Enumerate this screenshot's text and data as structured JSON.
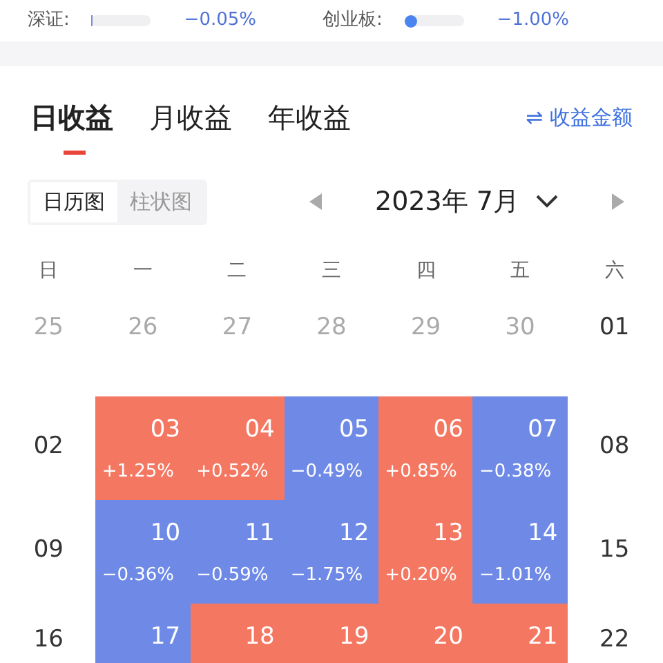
{
  "indices": [
    {
      "label": "深证:",
      "kind": "tick",
      "level": 0.0,
      "reading": "−0.05%"
    },
    {
      "label": "创业板:",
      "kind": "dot",
      "level": 0.0,
      "reading": "−1.00%"
    }
  ],
  "tabs": [
    {
      "label": "日收益",
      "selected": true
    },
    {
      "label": "月收益",
      "selected": false
    },
    {
      "label": "年收益",
      "selected": false
    }
  ],
  "toggle_link": {
    "icon": "⇌",
    "label": "收益金额"
  },
  "views": [
    {
      "label": "日历图",
      "selected": true
    },
    {
      "label": "柱状图",
      "selected": false
    }
  ],
  "month": {
    "label": "2023年 7月"
  },
  "weekdays": [
    "日",
    "一",
    "二",
    "三",
    "四",
    "五",
    "六"
  ],
  "weeks": [
    [
      {
        "day": "25",
        "muted": true
      },
      {
        "day": "26",
        "muted": true
      },
      {
        "day": "27",
        "muted": true
      },
      {
        "day": "28",
        "muted": true
      },
      {
        "day": "29",
        "muted": true
      },
      {
        "day": "30",
        "muted": true
      },
      {
        "day": "01",
        "muted": false
      }
    ],
    [
      {
        "day": "02",
        "muted": false
      },
      {
        "day": "03",
        "change": "+1.25%",
        "color": "#f47762"
      },
      {
        "day": "04",
        "change": "+0.52%",
        "color": "#f47762"
      },
      {
        "day": "05",
        "change": "−0.49%",
        "color": "#6f8ae6"
      },
      {
        "day": "06",
        "change": "+0.85%",
        "color": "#f47762"
      },
      {
        "day": "07",
        "change": "−0.38%",
        "color": "#6f8ae6"
      },
      {
        "day": "08",
        "muted": false
      }
    ],
    [
      {
        "day": "09",
        "muted": false
      },
      {
        "day": "10",
        "change": "−0.36%",
        "color": "#6f8ae6"
      },
      {
        "day": "11",
        "change": "−0.59%",
        "color": "#6f8ae6"
      },
      {
        "day": "12",
        "change": "−1.75%",
        "color": "#6f8ae6"
      },
      {
        "day": "13",
        "change": "+0.20%",
        "color": "#f47762"
      },
      {
        "day": "14",
        "change": "−1.01%",
        "color": "#6f8ae6"
      },
      {
        "day": "15",
        "muted": false
      }
    ],
    [
      {
        "day": "16",
        "muted": false
      },
      {
        "day": "17",
        "color": "#6f8ae6"
      },
      {
        "day": "18",
        "color": "#f47762"
      },
      {
        "day": "19",
        "color": "#f47762"
      },
      {
        "day": "20",
        "color": "#f47762"
      },
      {
        "day": "21",
        "color": "#f47762"
      },
      {
        "day": "22",
        "muted": false
      }
    ]
  ]
}
